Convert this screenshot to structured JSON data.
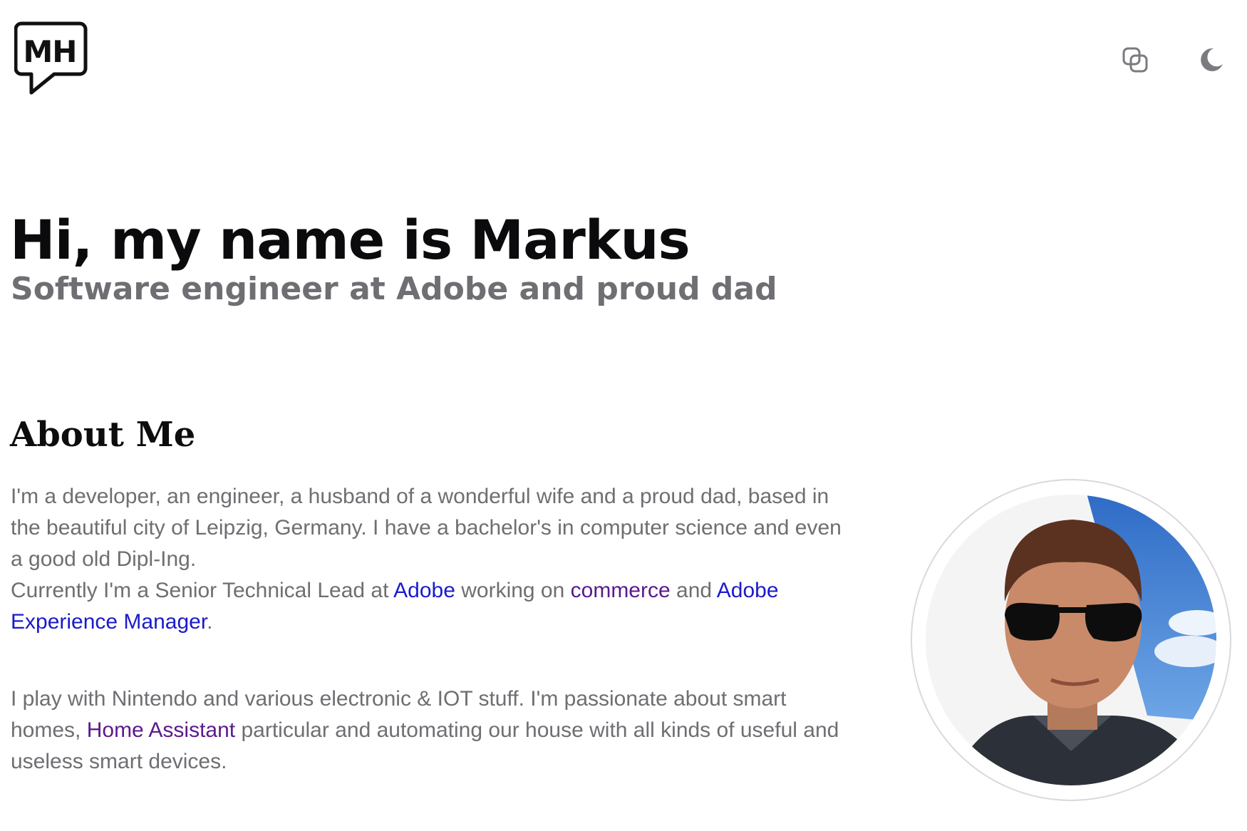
{
  "header": {
    "logo_text": "MH",
    "logo_icon": "speech-bubble-logo-icon",
    "contrast_icon": "overlapping-squares-icon",
    "theme_icon": "moon-icon"
  },
  "hero": {
    "title": "Hi, my name is Markus",
    "subtitle": "Software engineer at Adobe and proud dad"
  },
  "about": {
    "heading": "About Me",
    "para1": {
      "text1": "I'm a developer, an engineer, a husband of a wonderful wife and a proud dad, based in the beautiful city of Leipzig, Germany. I have a bachelor's in computer science and even a good old Dipl-Ing.",
      "text2": "Currently I'm a Senior Technical Lead at ",
      "link_adobe": "Adobe",
      "text3": " working on ",
      "link_commerce": "commerce",
      "text4": " and ",
      "link_aem": "Adobe Experience Manager",
      "text5": "."
    },
    "para2": {
      "text1": "I play with Nintendo and various electronic & IOT stuff. I'm passionate about smart homes, ",
      "link_ha": "Home Assistant",
      "text2": " particular and automating our house with all kinds of useful and useless smart devices."
    },
    "avatar_icon": "profile-photo"
  },
  "colors": {
    "link": "#1a1acc",
    "link_visited": "#5a1a8c",
    "muted_text": "#6e6e73",
    "heading": "#0b0b0d"
  }
}
